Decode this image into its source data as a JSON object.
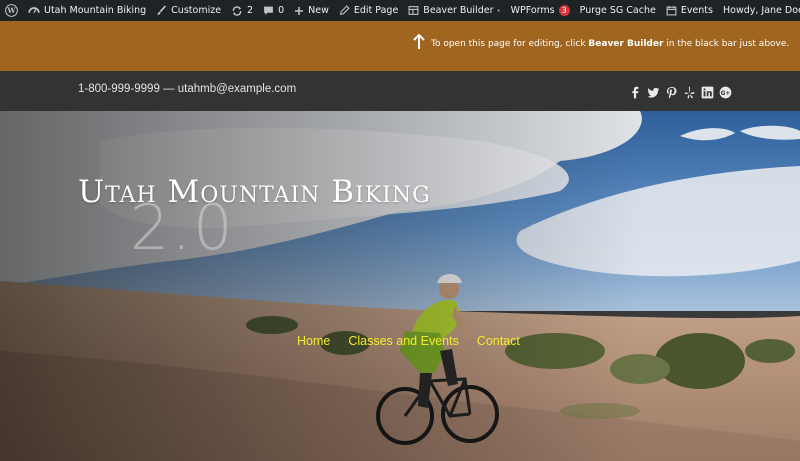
{
  "adminbar": {
    "site_name": "Utah Mountain Biking",
    "customize": "Customize",
    "updates_count": "2",
    "comments_count": "0",
    "new": "New",
    "edit_page": "Edit Page",
    "beaver_builder": "Beaver Builder",
    "beaver_builder_caret": "•",
    "wpforms": "WPForms",
    "wpforms_badge": "3",
    "purge_cache": "Purge SG Cache",
    "events": "Events",
    "howdy": "Howdy, Jane Doe"
  },
  "notice": {
    "text_before": "To open this page for editing, click ",
    "text_bold": "Beaver Builder",
    "text_after": " in the black bar just above."
  },
  "topbar": {
    "contact": "1-800-999-9999 — utahmb@example.com",
    "social_icons": [
      "facebook-icon",
      "twitter-icon",
      "pinterest-icon",
      "yelp-icon",
      "linkedin-icon",
      "google-plus-icon"
    ]
  },
  "hero": {
    "site_title": "Utah Mountain Biking",
    "subtitle": "2.0",
    "nav": [
      "Home",
      "Classes and Events",
      "Contact"
    ]
  },
  "colors": {
    "adminbar_bg": "#1d2327",
    "notice_bg": "#a0651f",
    "topbar_bg": "#333333",
    "nav_link": "#f4ec2b",
    "badge": "#d63638"
  }
}
